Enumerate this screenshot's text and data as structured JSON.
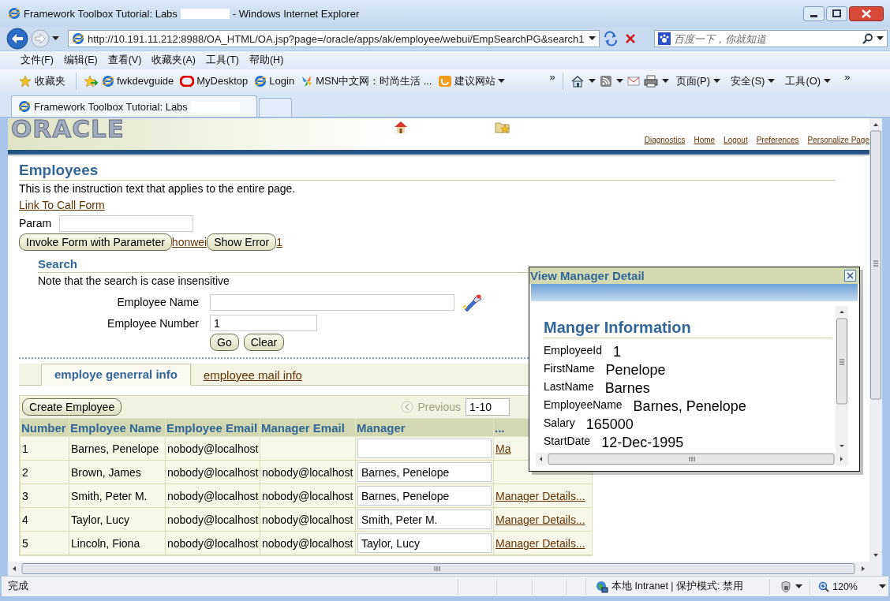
{
  "window": {
    "title": "Framework Toolbox Tutorial: Labs",
    "app_name": "- Windows Internet Explorer"
  },
  "address_bar": {
    "url": "http://10.191.11.212:8988/OA_HTML/OA.jsp?page=/oracle/apps/ak/employee/webui/EmpSearchPG&search1",
    "search_placeholder": "百度一下，你就知道"
  },
  "menu": [
    "文件(F)",
    "编辑(E)",
    "查看(V)",
    "收藏夹(A)",
    "工具(T)",
    "帮助(H)"
  ],
  "favorites_bar": {
    "favorites": "收藏夹",
    "links": [
      {
        "label": "fwkdevguide",
        "kind": "ie"
      },
      {
        "label": "MyDesktop",
        "kind": "oracle"
      },
      {
        "label": "Login",
        "kind": "ie"
      },
      {
        "label": "MSN中文网：时尚生活 ...",
        "kind": "msn"
      },
      {
        "label": "建议网站",
        "kind": "suggest"
      }
    ],
    "overflow": "»",
    "commands": [
      "页面(P)",
      "安全(S)",
      "工具(O)"
    ],
    "commands_overflow": "»"
  },
  "browser_tabs": [
    {
      "label": "Framework Toolbox Tutorial: Labs",
      "selected": true
    }
  ],
  "page": {
    "logo": "ORACLE",
    "global_links": [
      "Diagnostics",
      "Home",
      "Logout",
      "Preferences",
      "Personalize Page"
    ],
    "heading": "Employees",
    "instruction": "This is the instruction text that applies to the entire page.",
    "call_form_link": "Link To Call Form",
    "param_label": "Param",
    "actions": [
      {
        "kind": "button",
        "label": "Invoke Form with Parameter"
      },
      {
        "kind": "link",
        "label": "honwei"
      },
      {
        "kind": "button",
        "label": "Show Error"
      },
      {
        "kind": "link",
        "label": "1"
      }
    ],
    "search": {
      "heading": "Search",
      "note": "Note that the search is case insensitive",
      "fields": [
        {
          "label": "Employee Name",
          "kind": "lov"
        },
        {
          "label": "Employee Number",
          "kind": "text",
          "value": "1"
        }
      ],
      "buttons": [
        "Go",
        "Clear"
      ]
    },
    "subtabs": [
      {
        "label": "employe generral info",
        "selected": true
      },
      {
        "label": "employee mail info",
        "selected": false
      }
    ],
    "table": {
      "create_button": "Create Employee",
      "previous": {
        "label": "Previous",
        "disabled": true
      },
      "range": "1-10",
      "columns": [
        "Number",
        "Employee Name",
        "Employee Email",
        "Manager Email",
        "Manager",
        "..."
      ],
      "rows": [
        {
          "number": "1",
          "name": "Barnes, Penelope",
          "email": "nobody@localhost",
          "details": "Ma"
        },
        {
          "number": "2",
          "name": "Brown, James",
          "email": "nobody@localhost",
          "manager_email": "nobody@localhost",
          "manager": "Barnes, Penelope"
        },
        {
          "number": "3",
          "name": "Smith, Peter M.",
          "email": "nobody@localhost",
          "manager_email": "nobody@localhost",
          "manager": "Barnes, Penelope",
          "details": "Manager Details..."
        },
        {
          "number": "4",
          "name": "Taylor, Lucy",
          "email": "nobody@localhost",
          "manager_email": "nobody@localhost",
          "manager": "Smith, Peter M.",
          "details": "Manager Details..."
        },
        {
          "number": "5",
          "name": "Lincoln, Fiona",
          "email": "nobody@localhost",
          "manager_email": "nobody@localhost",
          "manager": "Taylor, Lucy",
          "details": "Manager Details..."
        }
      ]
    }
  },
  "dialog": {
    "title": "View Manager Detail",
    "heading": "Manger Information",
    "fields": [
      {
        "label": "EmployeeId",
        "value": "1"
      },
      {
        "label": "FirstName",
        "value": "Penelope"
      },
      {
        "label": "LastName",
        "value": "Barnes"
      },
      {
        "label": "EmployeeName",
        "value": "Barnes, Penelope"
      },
      {
        "label": "Salary",
        "value": "165000"
      },
      {
        "label": "StartDate",
        "value": "12-Dec-1995"
      }
    ]
  },
  "status_bar": {
    "text": "完成",
    "zone": "本地 Intranet | 保护模式: 禁用",
    "zoom": "120%"
  }
}
